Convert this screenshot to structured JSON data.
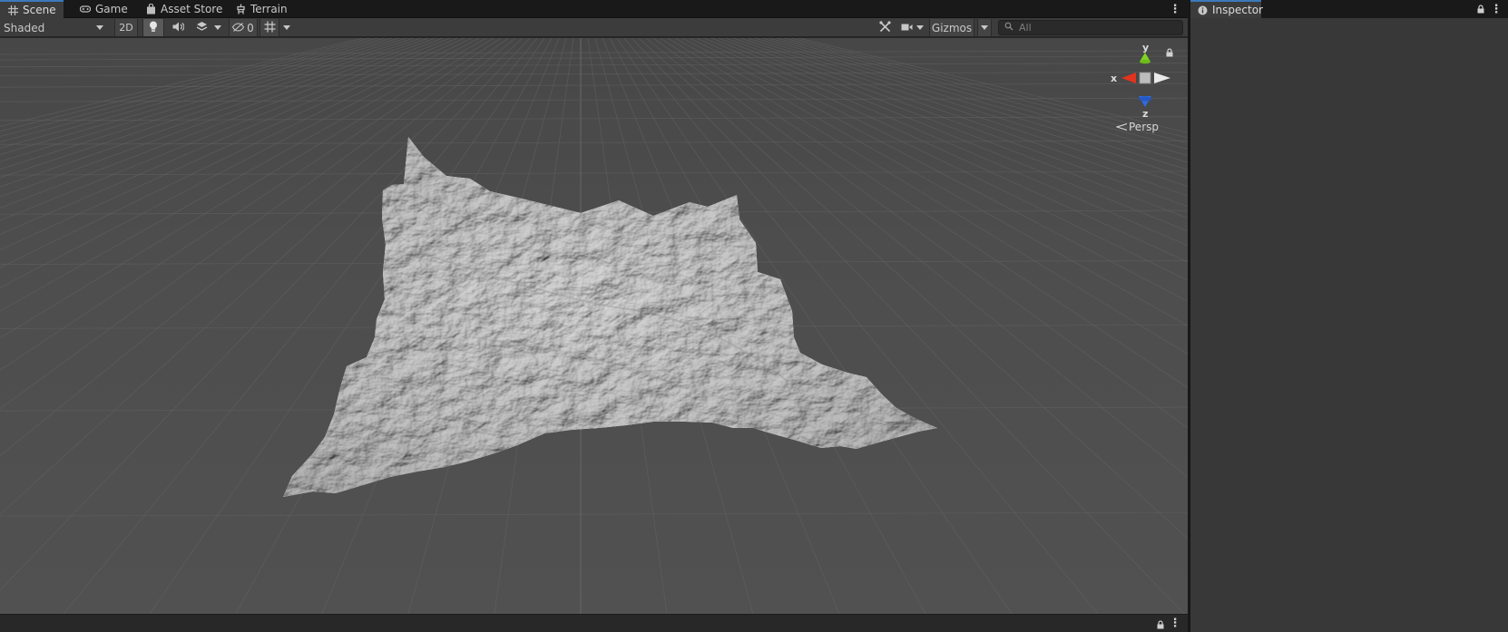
{
  "scene": {
    "tabs": [
      {
        "label": "Scene",
        "icon": "grid-icon"
      },
      {
        "label": "Game",
        "icon": "gamepad-icon"
      },
      {
        "label": "Asset Store",
        "icon": "bag-icon"
      },
      {
        "label": "Terrain",
        "icon": "tool-icon"
      }
    ],
    "toolbar": {
      "shading_mode": "Shaded",
      "mode_2d": "2D",
      "hidden_count": "0",
      "gizmos_label": "Gizmos",
      "search_placeholder": "All"
    },
    "gizmo": {
      "y_label": "y",
      "x_label": "x",
      "z_label": "z",
      "projection": "Persp"
    }
  },
  "inspector": {
    "tab_label": "Inspector",
    "icon": "info-icon"
  },
  "colors": {
    "tab_active_accent": "#3a79bb",
    "viewport_bg": "#505050",
    "grid_line": "#626262",
    "terrain": "#cfcfcf",
    "axis_x": "#e0341f",
    "axis_y": "#7ed321",
    "axis_z": "#2f6be0"
  }
}
